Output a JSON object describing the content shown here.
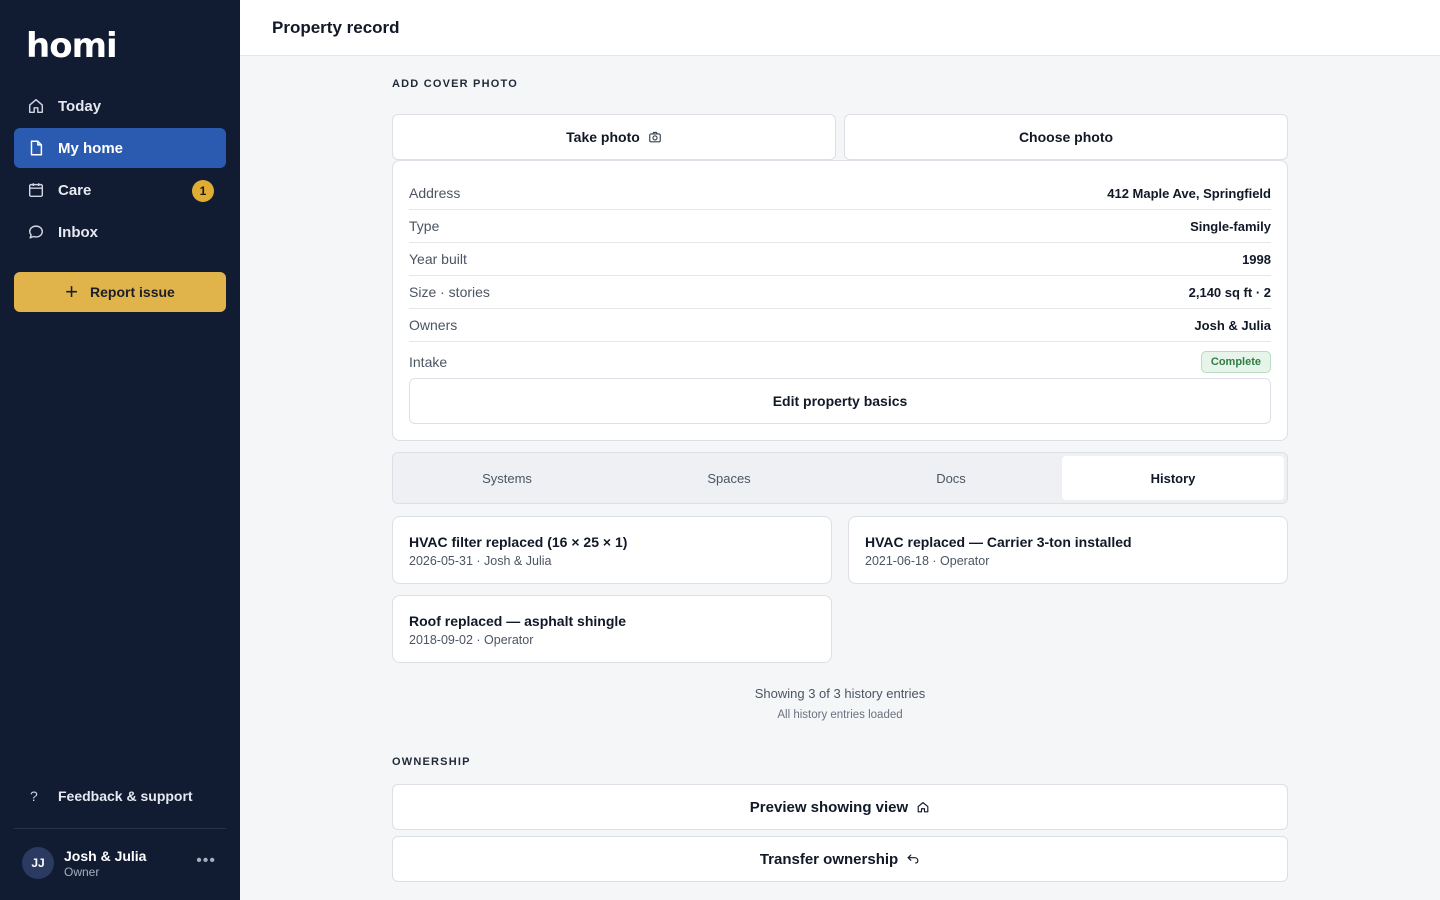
{
  "app": {
    "logo": "homi"
  },
  "sidebar": {
    "items": [
      {
        "label": "Today",
        "icon": "home-icon",
        "active": false
      },
      {
        "label": "My home",
        "icon": "document-icon",
        "active": true
      },
      {
        "label": "Care",
        "icon": "calendar-icon",
        "active": false,
        "badge": "1"
      },
      {
        "label": "Inbox",
        "icon": "chat-icon",
        "active": false
      }
    ],
    "report_button": "Report issue",
    "feedback": "Feedback & support",
    "user": {
      "initials": "JJ",
      "name": "Josh & Julia",
      "role": "Owner"
    }
  },
  "header": {
    "title": "Property record"
  },
  "cover": {
    "section_label": "ADD COVER PHOTO",
    "take_photo": "Take photo",
    "choose_photo": "Choose photo"
  },
  "property": {
    "rows": [
      {
        "label": "Address",
        "value": "412 Maple Ave, Springfield"
      },
      {
        "label": "Type",
        "value": "Single-family"
      },
      {
        "label": "Year built",
        "value": "1998"
      },
      {
        "label": "Size · stories",
        "value": "2,140 sq ft · 2"
      },
      {
        "label": "Owners",
        "value": "Josh & Julia"
      }
    ],
    "intake_label": "Intake",
    "intake_status": "Complete",
    "edit_button": "Edit property basics"
  },
  "tabs": [
    {
      "label": "Systems",
      "active": false
    },
    {
      "label": "Spaces",
      "active": false
    },
    {
      "label": "Docs",
      "active": false
    },
    {
      "label": "History",
      "active": true
    }
  ],
  "history": {
    "entries": [
      {
        "title": "HVAC filter replaced (16 × 25 × 1)",
        "meta": "2026-05-31 · Josh & Julia"
      },
      {
        "title": "HVAC replaced — Carrier 3-ton installed",
        "meta": "2021-06-18 · Operator"
      },
      {
        "title": "Roof replaced — asphalt shingle",
        "meta": "2018-09-02 · Operator"
      }
    ],
    "showing": "Showing 3 of 3 history entries",
    "loaded": "All history entries loaded"
  },
  "ownership": {
    "section_label": "OWNERSHIP",
    "preview_button": "Preview showing view",
    "transfer_button": "Transfer ownership"
  },
  "colors": {
    "sidebar_bg": "#111c33",
    "active_nav": "#2b5bb0",
    "accent": "#e0b44a",
    "success": "#2f7d46"
  }
}
